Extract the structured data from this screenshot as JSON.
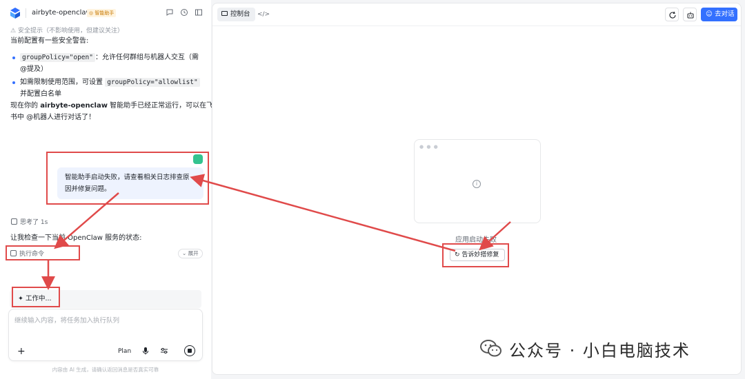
{
  "header": {
    "app_name": "airbyte-openclaw",
    "badge": "智能助手"
  },
  "chat": {
    "warning_partial": "安全提示（不影响使用，但建议关注）",
    "intro": "当前配置有一些安全警告:",
    "bullet1_code": "groupPolicy=\"open\"",
    "bullet1_text1": "：允许任何群组与机器人交互（需",
    "bullet1_text2": "@提及）",
    "bullet2_text1": "如需限制使用范围，可设置",
    "bullet2_code": "groupPolicy=\"allowlist\"",
    "bullet2_text2": "并配置白名单",
    "summary1_a": "现在你的",
    "summary1_bold": "airbyte-openclaw",
    "summary1_b": "智能助手已经正常运行，可以在飞",
    "summary2": "书中 @机器人进行对话了！",
    "user_msg_line1": "智能助手启动失败，请查看相关日志排查原",
    "user_msg_line2": "因并修复问题。",
    "thinking": "思考了 1s",
    "check_line": "让我检查一下当前 OpenClaw 服务的状态:",
    "exec_cmd": "执行命令",
    "expand": "展开",
    "working": "✦  工作中...",
    "composer_placeholder": "继续输入内容，将任务加入执行队列",
    "plus": "+",
    "plan": "Plan",
    "disclaimer": "内容由 AI 生成，请确认返回消息是否真实可靠"
  },
  "right": {
    "tab_console": "控制台",
    "tab_code": "</>",
    "go_chat": "去对话",
    "preview_dots": "● ● ●",
    "fail_text": "应用启动失败",
    "fix_button": "告诉妙搭修复"
  },
  "watermark": {
    "text": "公众号 · 小白电脑技术"
  },
  "colors": {
    "accent": "#3370ff",
    "annotation": "#e04a4a"
  }
}
